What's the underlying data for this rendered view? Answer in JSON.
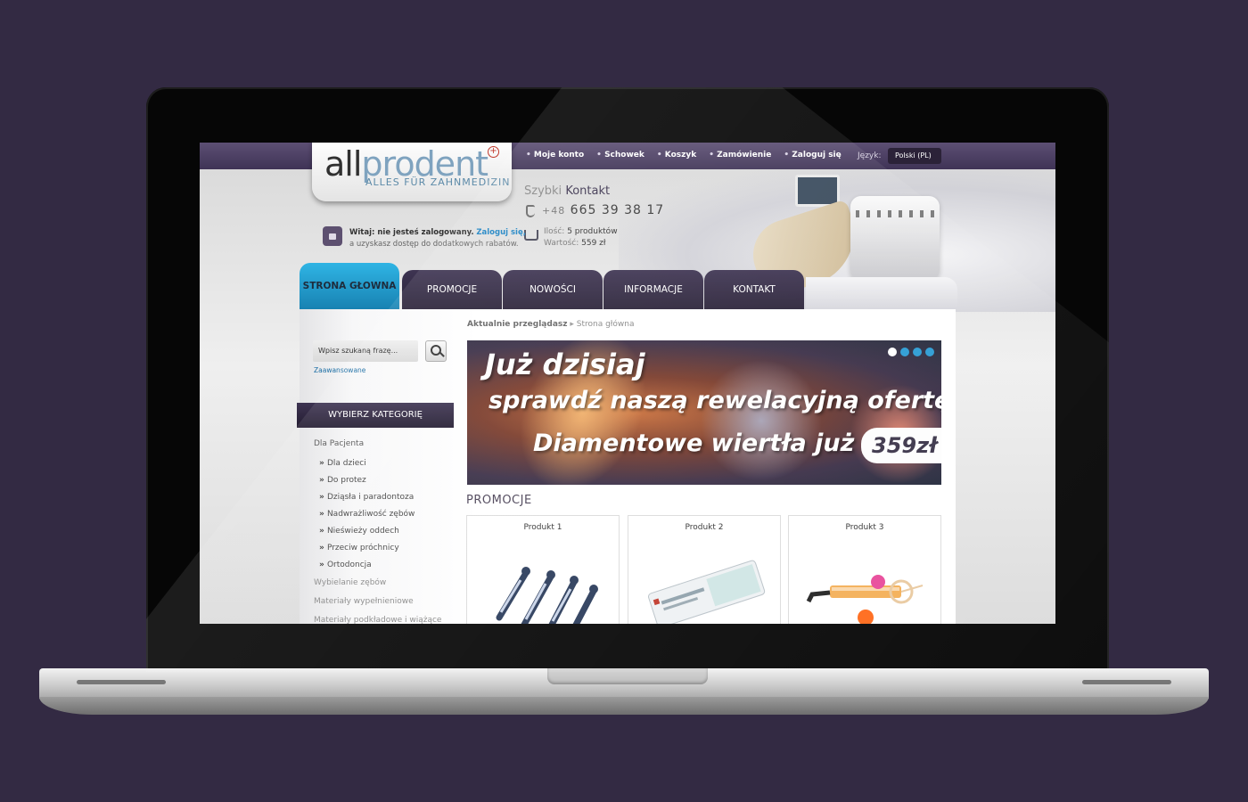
{
  "site": {
    "logo_main_a": "all",
    "logo_main_b": "prodent",
    "logo_tagline": "ALLES FÜR ZAHNMEDIZIN",
    "logo_cross": "+"
  },
  "topnav": {
    "items": [
      "Moje konto",
      "Schowek",
      "Koszyk",
      "Zamówienie",
      "Zaloguj się"
    ],
    "lang_label": "Język:",
    "lang_value": "Polski (PL)"
  },
  "contact": {
    "title_a": "Szybki",
    "title_b": "Kontakt",
    "phone_prefix": "+48",
    "phone_number": "665 39 38 17"
  },
  "cart": {
    "qty_label": "Ilość:",
    "qty_value": "5 produktów",
    "value_label": "Wartość:",
    "value_value": "559 zł"
  },
  "login": {
    "greeting": "Witaj: nie jesteś zalogowany.",
    "login_link": "Zaloguj się,",
    "note": "a uzyskasz dostęp do dodatkowych rabatów."
  },
  "tabs": [
    "STRONA GŁOWNA",
    "PROMOCJE",
    "NOWOŚCI",
    "INFORMACJE",
    "KONTAKT"
  ],
  "search": {
    "placeholder": "Wpisz szukaną frazę...",
    "advanced": "Zaawansowane"
  },
  "categories": {
    "header": "WYBIERZ KATEGORIĘ",
    "group": "Dla Pacjenta",
    "sub": [
      "Dla dzieci",
      "Do protez",
      "Dziąsła i paradontoza",
      "Nadwrażliwość zębów",
      "Nieświeży oddech",
      "Przeciw próchnicy",
      "Ortodoncja"
    ],
    "more": [
      "Wybielanie zębów",
      "Materiały wypełnieniowe",
      "Materiały podkładowe i wiążące"
    ]
  },
  "breadcrumb": {
    "label": "Aktualnie przeglądasz",
    "current": "Strona główna"
  },
  "banner": {
    "line1": "Już dzisiaj",
    "line2": "sprawdź naszą rewelacyjną ofertę:",
    "line3": "Diamentowe wiertła już od",
    "price": "359zł",
    "slides_total": 4,
    "slide_active": 1
  },
  "promotions": {
    "title": "PROMOCJE",
    "products": [
      "Produkt 1",
      "Produkt 2",
      "Produkt 3"
    ]
  }
}
